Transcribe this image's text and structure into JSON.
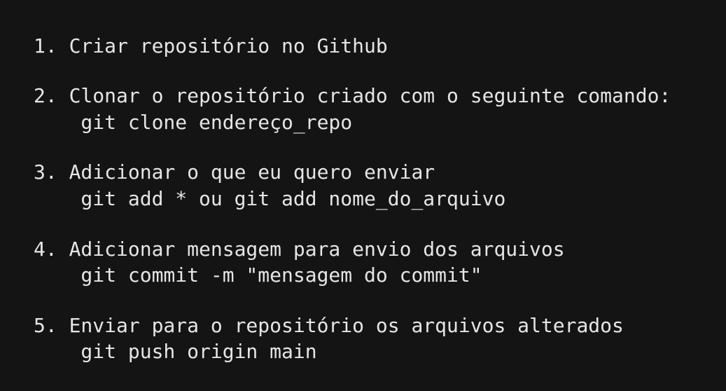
{
  "steps": [
    {
      "title": "1. Criar repositório no Github"
    },
    {
      "title": "2. Clonar o repositório criado com o seguinte comando:",
      "command": "    git clone endereço_repo"
    },
    {
      "title": "3. Adicionar o que eu quero enviar",
      "command": "    git add * ou git add nome_do_arquivo"
    },
    {
      "title": "4. Adicionar mensagem para envio dos arquivos",
      "command": "    git commit -m \"mensagem do commit\""
    },
    {
      "title": "5. Enviar para o repositório os arquivos alterados",
      "command": "    git push origin main"
    }
  ]
}
